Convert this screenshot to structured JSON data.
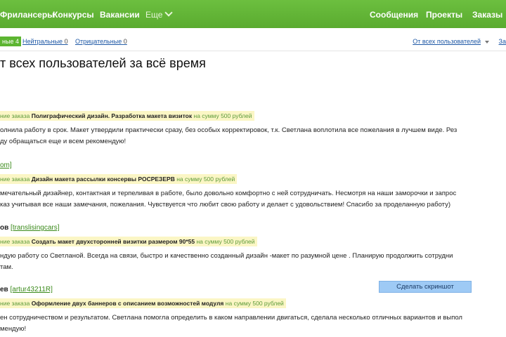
{
  "nav": {
    "left": [
      "Фрилансеры",
      "Конкурсы",
      "Вакансии"
    ],
    "more": "Еще",
    "right": [
      "Сообщения",
      "Проекты",
      "Заказы"
    ]
  },
  "filters": {
    "positive": "ные 4",
    "neutral_label": "Нейтральные",
    "neutral_count": "0",
    "negative_label": "Отрицательные",
    "negative_count": "0",
    "sort_label": "От всех пользователей",
    "sort_right": "За"
  },
  "page_title": "т всех пользователей за всё время",
  "reviews": [
    {
      "reviewer": "",
      "login": "",
      "order_prefix": "ние заказа",
      "order_title": "Полиграфический дизайн. Разработка макета визиток",
      "order_sum": "на сумму 500 рублей",
      "line1": "олнила работу в срок. Макет утвердили практически сразу, без особых корректировок, т.к. Светлана воплотила все пожелания в лучшем виде. Рез",
      "line2": "ду обращаться еще и всем рекомендую!"
    },
    {
      "reviewer": "",
      "login": "om]",
      "order_prefix": "ние заказа",
      "order_title": "Дизайн макета рассылки консервы РОСРЕЗЕРВ",
      "order_sum": "на сумму 500 рублей",
      "line1": "мечательный дизайнер, контактная и терпеливая в работе, было довольно комфортно с ней сотрудничать. Несмотря на наши заморочки и запрос",
      "line2": "каз учитывая все наши замечания, пожелания. Чувствуется что любит свою работу и делает с удовольствием! Спасибо за проделанную работу)"
    },
    {
      "reviewer": "ов",
      "login": "[translisingcars]",
      "order_prefix": "ние заказа",
      "order_title": "Создать макет двухсторонней визитки размером 90*55",
      "order_sum": "на сумму 500 рублей",
      "line1": "ндую работу со Светланой. Всегда на связи, быстро и качественно созданный дизайн -макет  по  разумной цене . Планирую продолжить сотрудни",
      "line2": "там."
    },
    {
      "reviewer": "ев",
      "login": "[artur43211R]",
      "order_prefix": "ние заказа",
      "order_title": "Оформление двух баннеров с описанием возможностей модуля",
      "order_sum": "на сумму 500 рублей",
      "line1": "ен сотрудничеством и результатом. Светлана помогла определить в каком направлении двигаться, сделала несколько отличных вариантов и выпол",
      "line2": "мендую!"
    }
  ],
  "screenshot_button": "Сделать скриншот"
}
